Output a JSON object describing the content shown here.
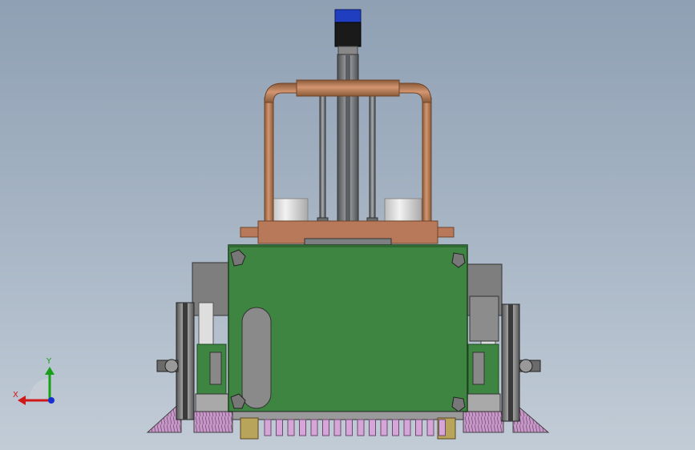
{
  "viewport": {
    "background_top": "#8fa0b4",
    "background_bottom": "#c2ccd7"
  },
  "model": {
    "panel_color": "#3f8542",
    "pipe_color": "#c0825c",
    "motor_cap_color": "#1f3fc0",
    "brush_color": "#cf9fcf",
    "nozzle_color": "#d7a6d9",
    "rail_color": "#7a7d80",
    "tank_color": "#dcdcdc"
  },
  "triad": {
    "x_label": "X",
    "y_label": "Y",
    "x_color": "#d01818",
    "y_color": "#18a018",
    "z_color": "#1830d0"
  }
}
